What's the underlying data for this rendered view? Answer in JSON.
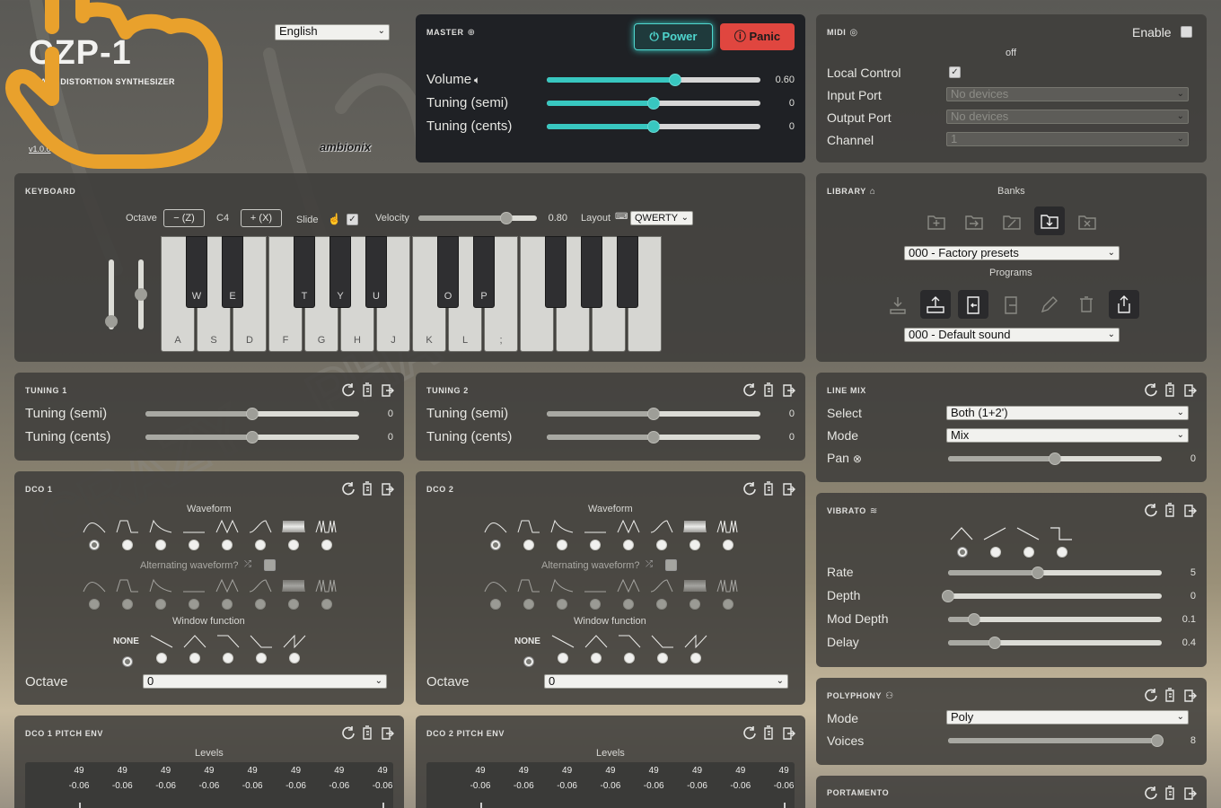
{
  "header": {
    "logo_title": "CZP-1",
    "subtitle": "PHASE DISTORTION SYNTHESIZER",
    "version": "v1.0.0",
    "brand": "ambionix",
    "language": "English"
  },
  "master": {
    "title": "MASTER",
    "power_label": "Power",
    "panic_label": "Panic",
    "rows": [
      {
        "label": "Volume",
        "value": "0.60",
        "level": 0.6
      },
      {
        "label": "Tuning (semi)",
        "value": "0",
        "level": 0.5
      },
      {
        "label": "Tuning (cents)",
        "value": "0",
        "level": 0.5
      }
    ]
  },
  "midi": {
    "title": "MIDI",
    "enable_label": "Enable",
    "status": "off",
    "local_control_label": "Local Control",
    "input_port_label": "Input Port",
    "input_port_value": "No devices",
    "output_port_label": "Output Port",
    "output_port_value": "No devices",
    "channel_label": "Channel",
    "channel_value": "1"
  },
  "keyboard": {
    "title": "KEYBOARD",
    "octave_label": "Octave",
    "octave_down": "− (Z)",
    "octave_value": "C4",
    "octave_up": "+ (X)",
    "slide_label": "Slide",
    "velocity_label": "Velocity",
    "velocity_value": "0.80",
    "velocity_level": 0.8,
    "layout_label": "Layout",
    "layout_value": "QWERTY",
    "white_keys": [
      "A",
      "S",
      "D",
      "F",
      "G",
      "H",
      "J",
      "K",
      "L",
      ";",
      "",
      "",
      "",
      ""
    ],
    "black_keys": [
      "W",
      "E",
      "T",
      "Y",
      "U",
      "O",
      "P",
      "",
      "",
      ""
    ]
  },
  "library": {
    "title": "LIBRARY",
    "banks_label": "Banks",
    "bank_value": "000 - Factory presets",
    "programs_label": "Programs",
    "program_value": "000 - Default sound"
  },
  "tuning1": {
    "title": "TUNING 1",
    "rows": [
      {
        "label": "Tuning (semi)",
        "value": "0",
        "level": 0.5
      },
      {
        "label": "Tuning (cents)",
        "value": "0",
        "level": 0.5
      }
    ]
  },
  "tuning2": {
    "title": "TUNING 2",
    "rows": [
      {
        "label": "Tuning (semi)",
        "value": "0",
        "level": 0.5
      },
      {
        "label": "Tuning (cents)",
        "value": "0",
        "level": 0.5
      }
    ]
  },
  "linemix": {
    "title": "LINE MIX",
    "select_label": "Select",
    "select_value": "Both (1+2')",
    "mode_label": "Mode",
    "mode_value": "Mix",
    "pan_label": "Pan",
    "pan_value": "0",
    "pan_level": 0.5
  },
  "dco1": {
    "title": "DCO 1",
    "waveform_label": "Waveform",
    "alt_label": "Alternating waveform?",
    "window_label": "Window function",
    "none_label": "NONE",
    "octave_label": "Octave",
    "octave_value": "0"
  },
  "dco2": {
    "title": "DCO 2",
    "waveform_label": "Waveform",
    "alt_label": "Alternating waveform?",
    "window_label": "Window function",
    "none_label": "NONE",
    "octave_label": "Octave",
    "octave_value": "0"
  },
  "vibrato": {
    "title": "VIBRATO",
    "rows": [
      {
        "label": "Rate",
        "value": "5",
        "level": 0.42
      },
      {
        "label": "Depth",
        "value": "0",
        "level": 0.0
      },
      {
        "label": "Mod Depth",
        "value": "0.1",
        "level": 0.12
      },
      {
        "label": "Delay",
        "value": "0.4",
        "level": 0.22
      }
    ]
  },
  "polyphony": {
    "title": "POLYPHONY",
    "mode_label": "Mode",
    "mode_value": "Poly",
    "voices_label": "Voices",
    "voices_value": "8",
    "voices_level": 0.98
  },
  "portamento": {
    "title": "PORTAMENTO"
  },
  "env1": {
    "title": "DCO 1 PITCH ENV",
    "levels_label": "Levels",
    "cols": [
      {
        "n": "49",
        "v": "-0.06"
      },
      {
        "n": "49",
        "v": "-0.06"
      },
      {
        "n": "49",
        "v": "-0.06"
      },
      {
        "n": "49",
        "v": "-0.06"
      },
      {
        "n": "49",
        "v": "-0.06"
      },
      {
        "n": "49",
        "v": "-0.06"
      },
      {
        "n": "49",
        "v": "-0.06"
      },
      {
        "n": "49",
        "v": "-0.06"
      }
    ]
  },
  "env2": {
    "title": "DCO 2 PITCH ENV",
    "levels_label": "Levels",
    "cols": [
      {
        "n": "49",
        "v": "-0.06"
      },
      {
        "n": "49",
        "v": "-0.06"
      },
      {
        "n": "49",
        "v": "-0.06"
      },
      {
        "n": "49",
        "v": "-0.06"
      },
      {
        "n": "49",
        "v": "-0.06"
      },
      {
        "n": "49",
        "v": "-0.06"
      },
      {
        "n": "49",
        "v": "-0.06"
      },
      {
        "n": "49",
        "v": "-0.06"
      }
    ]
  },
  "colors": {
    "teal": "#38c7c0",
    "panic": "#e0463f",
    "hand": "#e9a12c"
  }
}
